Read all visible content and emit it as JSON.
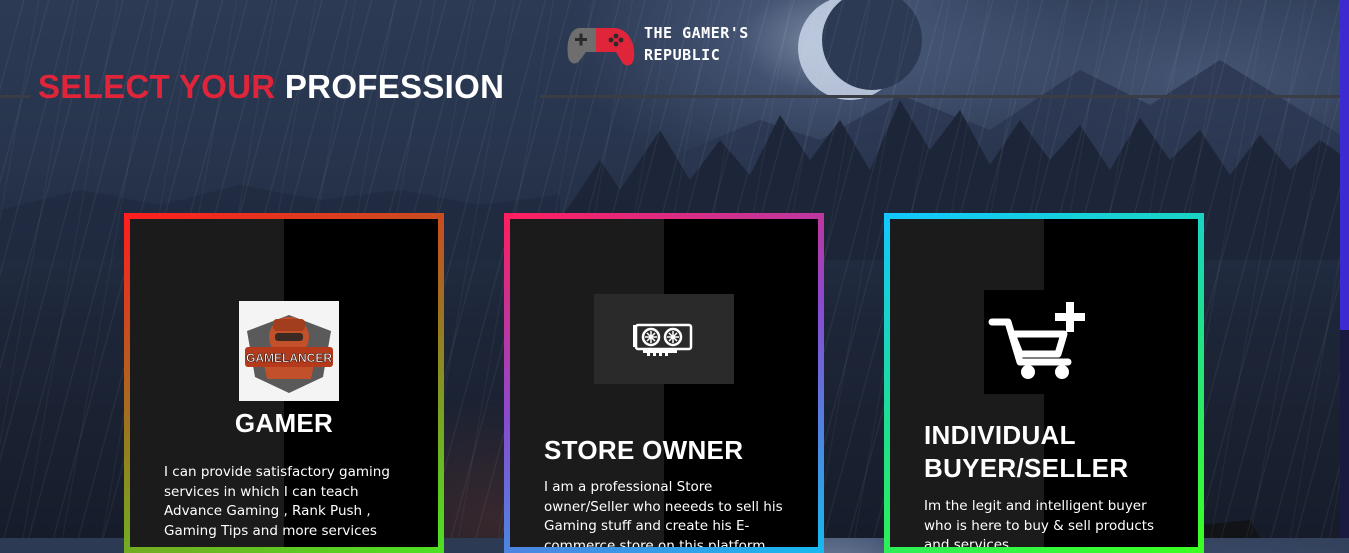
{
  "brand": {
    "line1": "THE GAMER'S",
    "line2": "REPUBLIC",
    "icon": "gamepad-icon",
    "accent": "#e0253a"
  },
  "headline": {
    "accent_text": "SELECT YOUR",
    "text": "PROFESSION",
    "accent_color": "#e0253a"
  },
  "cards": [
    {
      "image_text": "GAMELANCER",
      "title": "GAMER",
      "description": "I can provide satisfactory gaming services in which I can teach Advance Gaming , Rank Push , Gaming Tips and more services"
    },
    {
      "icon": "gpu-icon",
      "title": "STORE OWNER",
      "description": "I am a professional Store owner/Seller who neeeds to sell his Gaming stuff and create his E-commerce store on this platform"
    },
    {
      "icon": "cart-plus-icon",
      "title": "INDIVIDUAL BUYER/SELLER",
      "description": "Im the legit and intelligent buyer who is here to buy & sell products and services"
    }
  ]
}
